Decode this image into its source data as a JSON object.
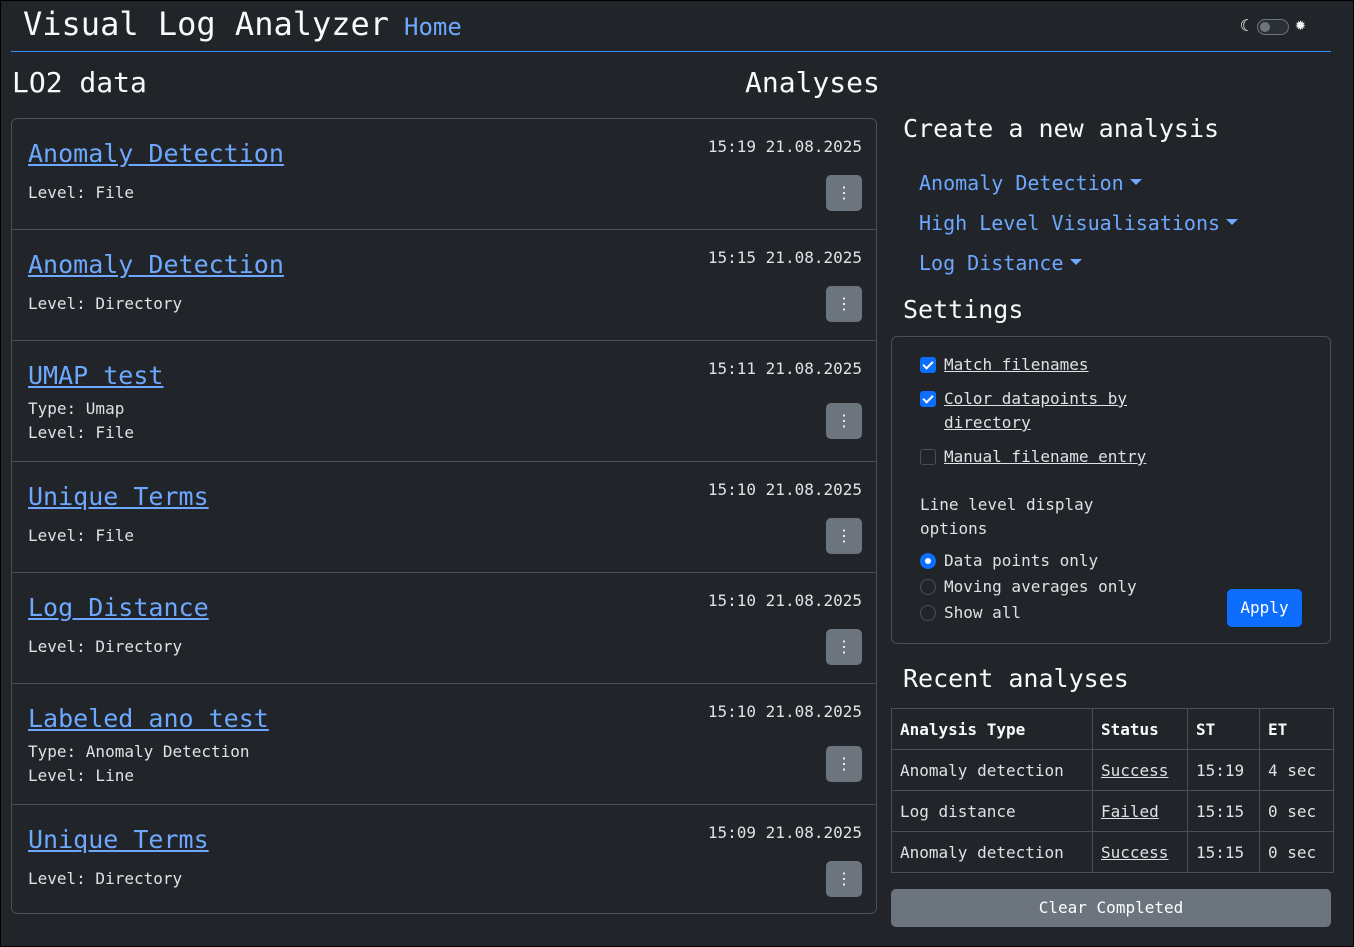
{
  "header": {
    "app_title": "Visual Log Analyzer",
    "home_link": "Home",
    "moon_icon": "☾",
    "sun_icon": "✹"
  },
  "left": {
    "title": "LO2 data"
  },
  "analyses": {
    "title": "Analyses",
    "items": [
      {
        "title": "Anomaly Detection",
        "time": "15:19 21.08.2025",
        "meta": [
          "Level: File"
        ]
      },
      {
        "title": "Anomaly Detection",
        "time": "15:15 21.08.2025",
        "meta": [
          "Level: Directory"
        ]
      },
      {
        "title": "UMAP test",
        "time": "15:11 21.08.2025",
        "meta": [
          "Type: Umap",
          "Level: File"
        ]
      },
      {
        "title": "Unique Terms",
        "time": "15:10 21.08.2025",
        "meta": [
          "Level: File"
        ]
      },
      {
        "title": "Log Distance",
        "time": "15:10 21.08.2025",
        "meta": [
          "Level: Directory"
        ]
      },
      {
        "title": "Labeled ano test",
        "time": "15:10 21.08.2025",
        "meta": [
          "Type: Anomaly Detection",
          "Level: Line"
        ]
      },
      {
        "title": "Unique Terms",
        "time": "15:09 21.08.2025",
        "meta": [
          "Level: Directory"
        ]
      }
    ]
  },
  "create": {
    "title": "Create a new analysis",
    "links": [
      "Anomaly Detection",
      "High Level Visualisations",
      "Log Distance"
    ]
  },
  "settings": {
    "title": "Settings",
    "checkboxes": [
      {
        "label_lines": [
          "Match filenames"
        ],
        "checked": true
      },
      {
        "label_lines": [
          "Color datapoints by",
          "directory"
        ],
        "checked": true
      },
      {
        "label_lines": [
          "Manual filename entry"
        ],
        "checked": false
      }
    ],
    "display_heading_lines": [
      "Line level display",
      "options"
    ],
    "radios": [
      {
        "label": "Data points only",
        "selected": true
      },
      {
        "label": "Moving averages only",
        "selected": false
      },
      {
        "label": "Show all",
        "selected": false
      }
    ],
    "apply_label": "Apply"
  },
  "recent": {
    "title": "Recent analyses",
    "columns": [
      "Analysis Type",
      "Status",
      "ST",
      "ET"
    ],
    "rows": [
      [
        "Anomaly detection",
        "Success",
        "15:19",
        "4 sec"
      ],
      [
        "Log distance",
        "Failed",
        "15:15",
        "0 sec"
      ],
      [
        "Anomaly detection",
        "Success",
        "15:15",
        "0 sec"
      ]
    ],
    "clear_label": "Clear Completed"
  },
  "kebab_icon": "⋮"
}
